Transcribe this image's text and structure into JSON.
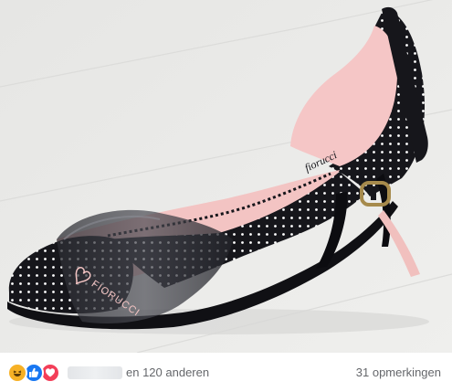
{
  "post": {
    "image": {
      "brand_logo": "FIORUCCI",
      "insole_logo": "fiorucci",
      "colors": {
        "floor": "#ebebea",
        "shoe_black": "#16161b",
        "dots": "#ffffff",
        "lining_pink": "#f5c6c6",
        "strap_pvc": "#3b3c43",
        "buckle": "#a68a4c"
      }
    },
    "reactions_bar": {
      "icons": [
        "laughing-emoji-icon",
        "like-thumb-icon",
        "love-heart-icon"
      ],
      "names_blurred": true,
      "others_text": "en 120 anderen",
      "comments_text": "31 opmerkingen"
    }
  }
}
